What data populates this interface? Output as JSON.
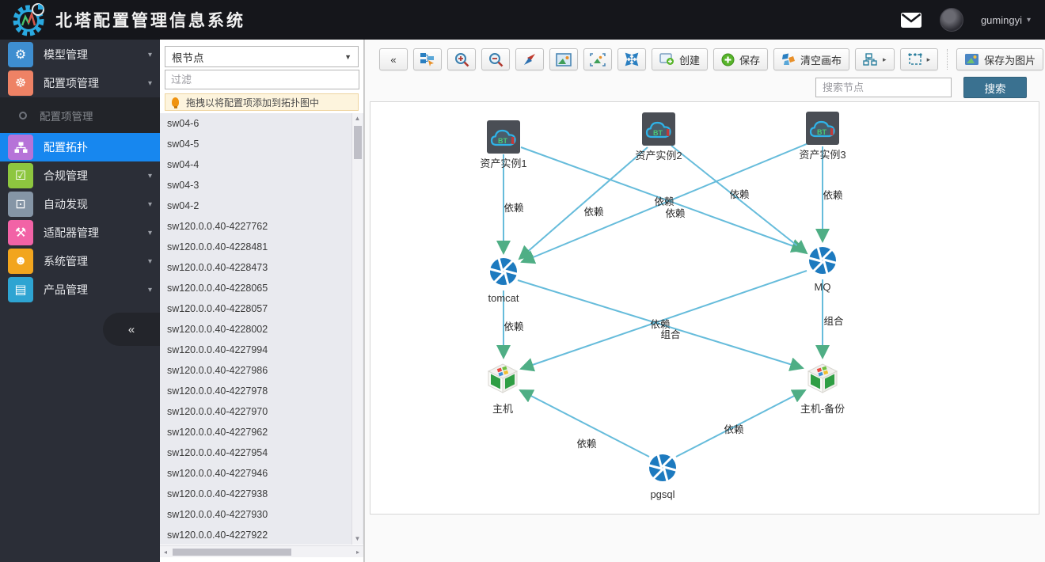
{
  "header": {
    "title": "北塔配置管理信息系统",
    "user": "gumingyi"
  },
  "icons": {
    "cogs": "⚙",
    "gear": "☸",
    "calendar_check": "☑",
    "crop": "⊡",
    "wrench": "⚒",
    "users": "☻",
    "document": "▤",
    "caret_down": "▾",
    "select_caret": "▼",
    "collapse_left": "«",
    "dropdown_caret": "▸",
    "scroll_up": "▲",
    "scroll_down": "▼",
    "scroll_left": "◂",
    "scroll_right": "▸"
  },
  "sidebar": {
    "items": [
      {
        "label": "模型管理",
        "color": "#3e8ed0"
      },
      {
        "label": "配置项管理",
        "color": "#ee8265"
      },
      {
        "label": "配置拓扑",
        "color": "#b673d8",
        "active": true
      },
      {
        "label": "合规管理",
        "color": "#8dc63f"
      },
      {
        "label": "自动发现",
        "color": "#8595a6"
      },
      {
        "label": "适配器管理",
        "color": "#f263a6"
      },
      {
        "label": "系统管理",
        "color": "#f2a51e"
      },
      {
        "label": "产品管理",
        "color": "#2ea4d2"
      }
    ],
    "sub_item": "配置项管理"
  },
  "tree_panel": {
    "root_select": "根节点",
    "filter_placeholder": "过滤",
    "hint": "拖拽以将配置项添加到拓扑图中",
    "items": [
      "sw04-6",
      "sw04-5",
      "sw04-4",
      "sw04-3",
      "sw04-2",
      "sw120.0.0.40-4227762",
      "sw120.0.0.40-4228481",
      "sw120.0.0.40-4228473",
      "sw120.0.0.40-4228065",
      "sw120.0.0.40-4228057",
      "sw120.0.0.40-4228002",
      "sw120.0.0.40-4227994",
      "sw120.0.0.40-4227986",
      "sw120.0.0.40-4227978",
      "sw120.0.0.40-4227970",
      "sw120.0.0.40-4227962",
      "sw120.0.0.40-4227954",
      "sw120.0.0.40-4227946",
      "sw120.0.0.40-4227938",
      "sw120.0.0.40-4227930",
      "sw120.0.0.40-4227922"
    ]
  },
  "toolbar": {
    "create": "创建",
    "save": "保存",
    "clear": "清空画布",
    "save_image": "保存为图片",
    "search_placeholder": "搜索节点",
    "search_button": "搜索"
  },
  "topology": {
    "asset_icon_text": "BT",
    "nodes": [
      {
        "id": "asset1",
        "label": "资产实例1",
        "type": "asset"
      },
      {
        "id": "asset2",
        "label": "资产实例2",
        "type": "asset"
      },
      {
        "id": "asset3",
        "label": "资产实例3",
        "type": "asset"
      },
      {
        "id": "tomcat",
        "label": "tomcat",
        "type": "app"
      },
      {
        "id": "mq",
        "label": "MQ",
        "type": "app"
      },
      {
        "id": "host",
        "label": "主机",
        "type": "host"
      },
      {
        "id": "host-backup",
        "label": "主机-备份",
        "type": "host"
      },
      {
        "id": "pgsql",
        "label": "pgsql",
        "type": "app"
      }
    ],
    "edges": [
      {
        "from": "资产实例1",
        "to": "tomcat",
        "label": "依赖"
      },
      {
        "from": "资产实例2",
        "to": "tomcat",
        "label": "依赖"
      },
      {
        "from": "资产实例3",
        "to": "tomcat",
        "label": "依赖"
      },
      {
        "from": "资产实例1",
        "to": "MQ",
        "label": "依赖"
      },
      {
        "from": "资产实例2",
        "to": "MQ",
        "label": "依赖"
      },
      {
        "from": "资产实例3",
        "to": "MQ",
        "label": "依赖"
      },
      {
        "from": "tomcat",
        "to": "主机",
        "label": "依赖"
      },
      {
        "from": "tomcat",
        "to": "主机-备份",
        "label": "组合"
      },
      {
        "from": "MQ",
        "to": "主机",
        "label": "依赖"
      },
      {
        "from": "MQ",
        "to": "主机-备份",
        "label": "组合"
      },
      {
        "from": "pgsql",
        "to": "主机",
        "label": "依赖"
      },
      {
        "from": "pgsql",
        "to": "主机-备份",
        "label": "依赖"
      }
    ]
  }
}
